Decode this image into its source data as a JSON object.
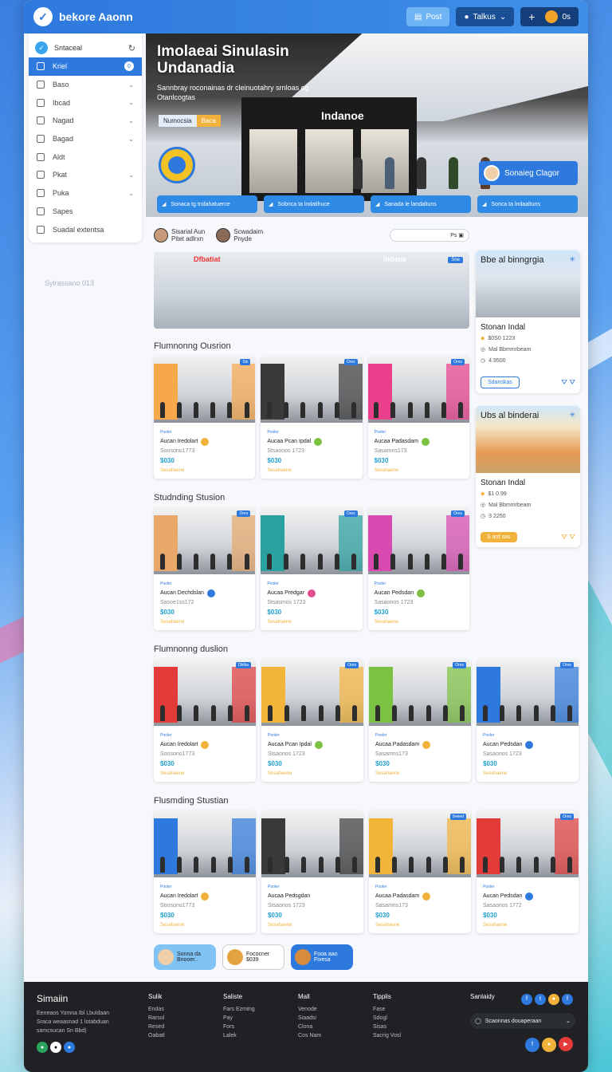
{
  "app": {
    "brand": "bekore Aaonn"
  },
  "topbar": {
    "post_label": "Post",
    "tabs_label": "Talkus",
    "user_label": "0s"
  },
  "sidebar": {
    "header": "Sntaceal",
    "items": [
      {
        "label": "Kriel",
        "icon": "home-icon",
        "active": true,
        "badge": "0"
      },
      {
        "label": "Baso",
        "icon": "grid-icon",
        "chevron": true
      },
      {
        "label": "Ibcad",
        "icon": "checkbox-icon",
        "chevron": true
      },
      {
        "label": "Nagad",
        "icon": "image-icon",
        "chevron": true
      },
      {
        "label": "Bagad",
        "icon": "chat-icon",
        "chevron": true
      },
      {
        "label": "Aldt",
        "icon": "circle-icon",
        "chevron": false
      },
      {
        "label": "Pkat",
        "icon": "tag-icon",
        "chevron": true
      },
      {
        "label": "Puka",
        "icon": "doc-icon",
        "chevron": true
      },
      {
        "label": "Sapes",
        "icon": "layers-icon",
        "chevron": false
      },
      {
        "label": "Suadal extentsa",
        "icon": "settings-icon",
        "chevron": false
      }
    ],
    "footer_note": "Sylrassano 013"
  },
  "hero": {
    "title": "Imolaeai Sinulasin Undanadia",
    "subtitle": "Sannbray roconainas dr cleinuotahry srnloas og Otanlcogtas",
    "tag1": "Numocsia",
    "tag2": "Baca",
    "shop_sign": "Indanoe",
    "chip_label": "Sonaieg Clagor",
    "buttons": [
      "Sonaca tg tndahatuerce",
      "Sobnca ta lndatihuce",
      "Sanada le landaltuns",
      "Sonca ta lndaaltuns"
    ]
  },
  "main": {
    "users": [
      {
        "line1": "Sisarial Aun",
        "line2": "Pitet adlrxn"
      },
      {
        "line1": "Scwadaim",
        "line2": "Pnyde"
      }
    ],
    "search_value": "Ps",
    "banner": {
      "sign_left": "Dfbatiat",
      "sign_right": "Indane",
      "badge": "Sne"
    },
    "sections": [
      {
        "title": "Flumnonng Ousrion",
        "cards": [
          {
            "cat": "Pooler",
            "name": "Aucan Iredolart",
            "sub": "Soosono1773",
            "price": "$030",
            "old": "Sesahaene",
            "tag": "Slx",
            "color": "#f7a84d",
            "emoji": "#f1b23c"
          },
          {
            "cat": "Pooler",
            "name": "Aucaa Pcan Ipdal",
            "sub": "Stsaonos 1723",
            "price": "$030",
            "old": "Sesahaene",
            "tag": "Ores",
            "color": "#3a3a3a",
            "emoji": "#7cc242"
          },
          {
            "cat": "Pooler",
            "name": "Aucaa Padasdam",
            "sub": "Sasamns173",
            "price": "$030",
            "old": "Sesahaene",
            "tag": "Ores",
            "color": "#ea3f8a",
            "emoji": "#7cc242"
          }
        ]
      },
      {
        "title": "Studnding Stusion",
        "cards": [
          {
            "cat": "Pooler",
            "name": "Aucan Dechdslan",
            "sub": "Sasoe1ss172",
            "price": "$030",
            "old": "Sesahaene",
            "tag": "Ores",
            "color": "#e7a86a",
            "emoji": "#2e79dd"
          },
          {
            "cat": "Pooler",
            "name": "Aucaa Predgar",
            "sub": "Stsasmos 1723",
            "price": "$030",
            "old": "Sesahaene",
            "tag": "Ores",
            "color": "#2aa0a0",
            "emoji": "#e64b8b"
          },
          {
            "cat": "Pooler",
            "name": "Aucan Pedsdan",
            "sub": "Sasaonos 1723",
            "price": "$030",
            "old": "Sesahaene",
            "tag": "Ores",
            "color": "#d94ab0",
            "emoji": "#7cc242"
          }
        ]
      },
      {
        "title": "Flumnonng duslion",
        "cards": [
          {
            "cat": "Pooler",
            "name": "Aucan Iredolart",
            "sub": "Soosono1773",
            "price": "$030",
            "old": "Sesahaene",
            "tag": "Dbtka",
            "color": "#e33a3a",
            "emoji": "#f1b23c"
          },
          {
            "cat": "Pooler",
            "name": "Aucaa Pcan Ipdal",
            "sub": "Stsaonos 1723",
            "price": "$030",
            "old": "Sesahaene",
            "tag": "Ores",
            "color": "#f3b43a",
            "emoji": "#7cc242"
          },
          {
            "cat": "Pooler",
            "name": "Aucaa Padasdam",
            "sub": "Sasamns173",
            "price": "$030",
            "old": "Sesahaene",
            "tag": "Ores",
            "color": "#7cc242",
            "emoji": "#f1b23c"
          },
          {
            "cat": "Pooler",
            "name": "Aucan Pedsdan",
            "sub": "Sasaonos 1723",
            "price": "$030",
            "old": "Sesahaene",
            "tag": "Ores",
            "color": "#2e79dd",
            "emoji": "#2e79dd"
          }
        ]
      },
      {
        "title": "Flusmding Stustian",
        "cards": [
          {
            "cat": "Pooler",
            "name": "Aucan Iredolart",
            "sub": "Soosono1773",
            "price": "$030",
            "old": "Sesahaene",
            "tag": "",
            "color": "#2e79dd",
            "emoji": "#f1b23c"
          },
          {
            "cat": "Pooler",
            "name": "Aucaa Pedsgdan",
            "sub": "Stsaonos 1723",
            "price": "$030",
            "old": "Sesahaene",
            "tag": "",
            "color": "#3a3a3a",
            "emoji": "#ffffff"
          },
          {
            "cat": "Pooler",
            "name": "Aucaa Padasdam",
            "sub": "Sasamns173",
            "price": "$030",
            "old": "Sesahaene",
            "tag": "Sneed",
            "color": "#f3b43a",
            "emoji": "#f1b23c"
          },
          {
            "cat": "Pooler",
            "name": "Aucan Pedsdan",
            "sub": "Sasaonos 1772",
            "price": "$030",
            "old": "Sesahaene",
            "tag": "Ores",
            "color": "#e33a3a",
            "emoji": "#2e79dd"
          }
        ]
      }
    ]
  },
  "right": {
    "cards": [
      {
        "title": "Bbe al binngrgia",
        "name": "Stonan Indal",
        "line1": "$0S0 1223",
        "line2": "Mal Bbmmrbeam",
        "line3": "4.9500",
        "button": "Sdanskas",
        "tone": "mall"
      },
      {
        "title": "Ubs al binderai",
        "name": "Stonan Indal",
        "line1": "$1 0.99",
        "line2": "Mal Bbmmrbeam",
        "line3": "3 2250",
        "button": "S ard sas",
        "tone": "food"
      }
    ]
  },
  "bottom_pills": [
    {
      "line1": "Sonna da",
      "line2": "Bnooer..",
      "bg": "#7fc3f5"
    },
    {
      "line1": "Fococner",
      "line2": "$039",
      "bg": "#ffffff"
    },
    {
      "line1": "Fooa aao",
      "line2": "Fivesa",
      "bg": "#2e79dd"
    }
  ],
  "footer": {
    "brand": "Simaiin",
    "brand_lines": [
      "Eeneaos Yomna Ibl Lbuldaan",
      "Sraca weaasnad 1 lotabduan",
      "samcsucan Sn Bbd)"
    ],
    "cols": [
      {
        "h": "Sulik",
        "lines": [
          "Endas",
          "Rarsol",
          "Resed",
          "Oabatl"
        ]
      },
      {
        "h": "Saliste",
        "lines": [
          "Fars Ezmtng",
          "Pay",
          "Fors",
          "Lalek"
        ]
      },
      {
        "h": "Mall",
        "lines": [
          "Venode",
          "Siaadsi",
          "Clona",
          "Cos Nam"
        ]
      },
      {
        "h": "Tipplis",
        "lines": [
          "Fase",
          "Sdogl",
          "Sisas",
          "Sacrig Vosl"
        ]
      }
    ],
    "social_label": "Sanlaidy",
    "select_value": "Scaonnas douaperaan"
  }
}
